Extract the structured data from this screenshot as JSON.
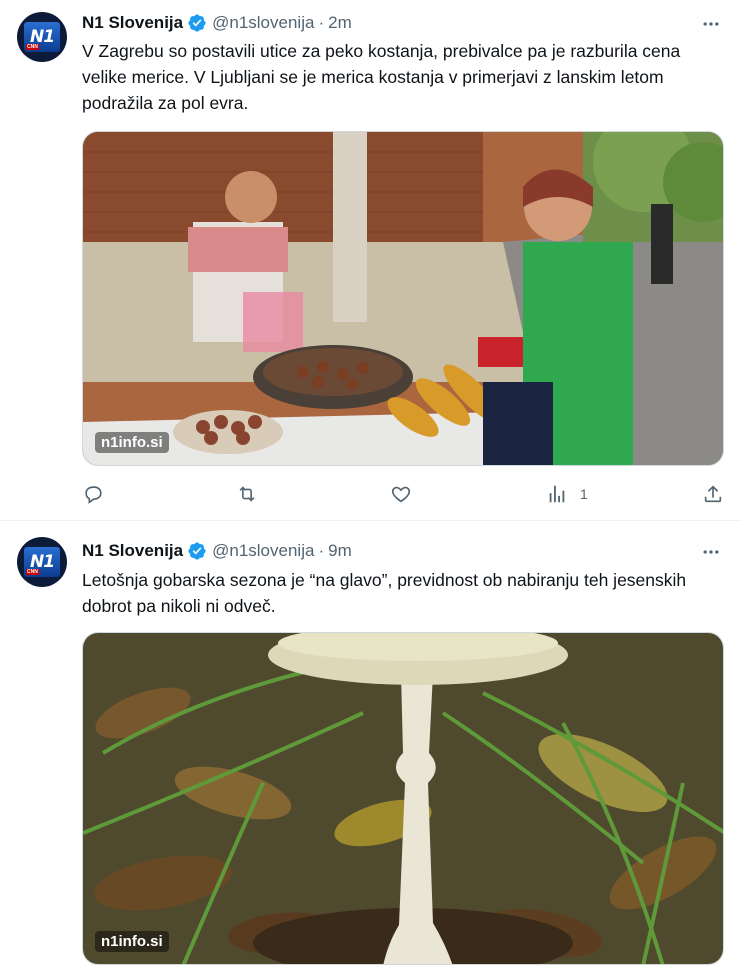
{
  "tweets": [
    {
      "display_name": "N1 Slovenija",
      "handle": "@n1slovenija",
      "separator": "·",
      "time": "2m",
      "text": "V Zagrebu so postavili utice za peko kostanja, prebivalce pa je razburila cena velike merice. V Ljubljani se je merica kostanja v primerjavi z lanskim letom podražila za pol evra.",
      "media_watermark": "n1info.si",
      "media_icon": "chestnut-vendor-photo",
      "actions": {
        "reply_icon": "reply-icon",
        "retweet_icon": "retweet-icon",
        "like_icon": "like-icon",
        "views_icon": "views-icon",
        "views_count": "1",
        "share_icon": "share-icon"
      }
    },
    {
      "display_name": "N1 Slovenija",
      "handle": "@n1slovenija",
      "separator": "·",
      "time": "9m",
      "text": "Letošnja gobarska sezona je “na glavo”, previdnost ob nabiranju teh jesenskih dobrot pa nikoli ni odveč.",
      "media_watermark": "n1info.si",
      "media_icon": "mushroom-photo"
    }
  ],
  "avatar": {
    "logo_text": "N1",
    "tag_text": "CNN"
  },
  "colors": {
    "verified": "#1d9bf0",
    "muted": "#536471",
    "text": "#0f1419",
    "border": "#eff3f4"
  }
}
